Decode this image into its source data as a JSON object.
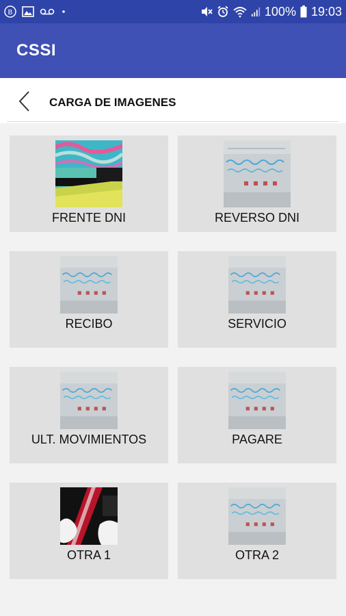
{
  "status_bar": {
    "battery_percent": "100%",
    "time": "19:03"
  },
  "app_bar": {
    "title": "CSSI"
  },
  "page_header": {
    "title": "CARGA DE IMAGENES"
  },
  "tiles": [
    {
      "label": "FRENTE DNI",
      "thumb": "dni-front-photo"
    },
    {
      "label": "REVERSO DNI",
      "thumb": "document-photo"
    },
    {
      "label": "RECIBO",
      "thumb": "document-photo"
    },
    {
      "label": "SERVICIO",
      "thumb": "document-photo"
    },
    {
      "label": "ULT. MOVIMIENTOS",
      "thumb": "document-photo"
    },
    {
      "label": "PAGARE",
      "thumb": "document-photo"
    },
    {
      "label": "OTRA 1",
      "thumb": "dark-photo"
    },
    {
      "label": "OTRA 2",
      "thumb": "document-photo"
    }
  ],
  "colors": {
    "status_bar": "#2f44a8",
    "app_bar": "#3f51b5",
    "tile_bg": "#e0e0e0"
  }
}
